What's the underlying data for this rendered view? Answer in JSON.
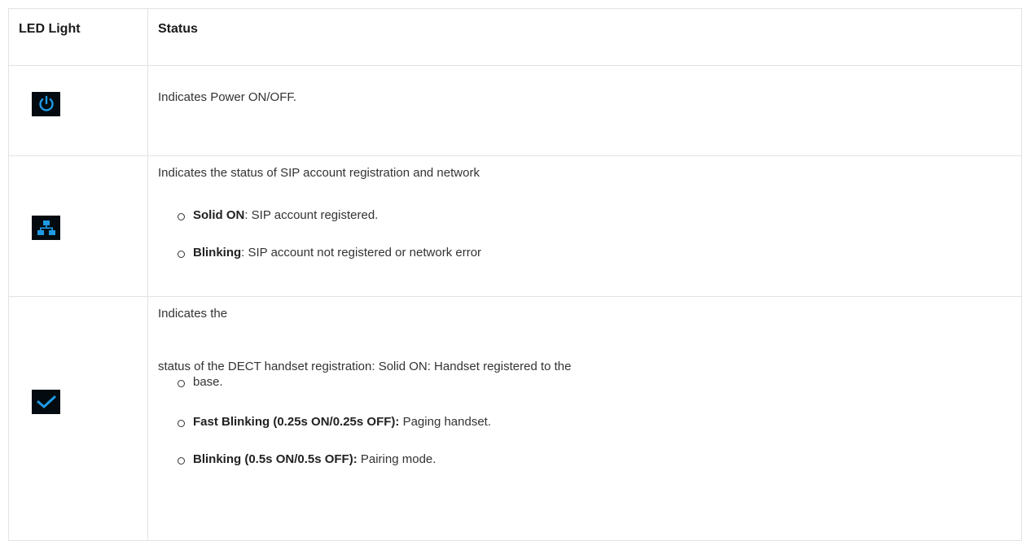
{
  "table": {
    "headers": {
      "led": "LED Light",
      "status": "Status"
    },
    "rows": [
      {
        "icon": "power-icon",
        "description": "Indicates Power ON/OFF."
      },
      {
        "icon": "network-icon",
        "description": "Indicates the status of SIP account registration and network",
        "items": [
          {
            "label": "Solid ON",
            "text": ": SIP account registered."
          },
          {
            "label": "Blinking",
            "text": ": SIP account not registered or network error"
          }
        ]
      },
      {
        "icon": "checkmark-icon",
        "description": "Indicates the",
        "continuation": "status of the DECT handset registration: Solid ON: Handset registered to the",
        "items": [
          {
            "label": "",
            "text": "base."
          },
          {
            "label": "Fast Blinking (0.25s ON/0.25s OFF):",
            "text": " Paging handset."
          },
          {
            "label": "Blinking (0.5s ON/0.5s OFF):",
            "text": " Pairing mode."
          }
        ]
      }
    ]
  },
  "colors": {
    "icon_background": "#030b10",
    "icon_blue": "#1e9be6",
    "border": "#e3e3e3",
    "text": "#333333"
  }
}
